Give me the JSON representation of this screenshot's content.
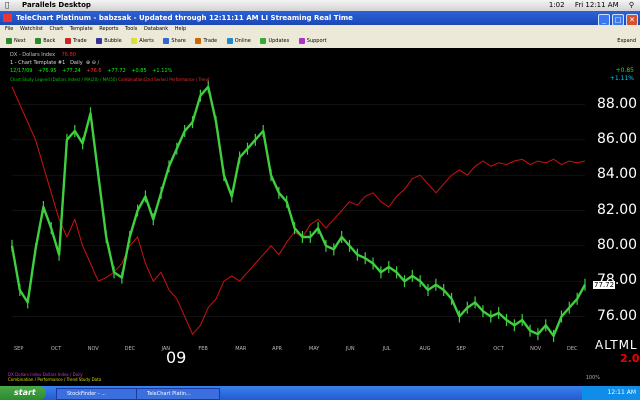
{
  "mac_menubar": {
    "app_name": "Parallels Desktop",
    "clock": "Fri 12:11 AM",
    "battery": "1:02"
  },
  "window": {
    "title": "TeleChart Platinum - babzsak - Updated through 12:11:11 AM LI  Streaming Real Time"
  },
  "menus": [
    "File",
    "Watchlist",
    "Chart",
    "Template",
    "Reports",
    "Tools",
    "Databank",
    "Help"
  ],
  "toolbar": {
    "buttons": [
      "Next",
      "Back",
      "Trade",
      "Bubble",
      "Alerts",
      "Share",
      "Trade",
      "Online",
      "Updates",
      "Support"
    ],
    "right_label": "Expand"
  },
  "chart_header": {
    "symbol_line": "DX - Dollars Index",
    "symbol_value": "76.80",
    "template_line": "1 - Chart Template #1",
    "interval": "Daily",
    "quote_line": [
      "12/17/09",
      "+76.95",
      "+77.24",
      "+76.6",
      "+77.72",
      "+0.85",
      "+1.11%"
    ],
    "indicator_line_a": "Chart Study Legend (Dollars Index) / MA(20) / MA(50)",
    "indicator_line_b": "Combination(2nd Series) Performance / Trend"
  },
  "top_right": {
    "change": "+0.85",
    "pct": "+1.11%"
  },
  "price_tag": "77.72",
  "bottom_right": {
    "altml": "ALTML",
    "value": "2.0"
  },
  "bottom_info": {
    "a": "DX  Dollars Index  Dollars Index / Daily",
    "b": "Combination / Performance / Trend  Study Data"
  },
  "status": "100%",
  "taskbar": {
    "start": "start",
    "tasks": [
      "StockFinder - ...",
      "TeleChart Platin..."
    ],
    "clock": "12:11 AM"
  },
  "chart_data": {
    "type": "line",
    "year_label": "09",
    "x": [
      "SEP",
      "OCT",
      "NOV",
      "DEC",
      "JAN",
      "FEB",
      "MAR",
      "APR",
      "MAY",
      "JUN",
      "JUL",
      "AUG",
      "SEP",
      "OCT",
      "NOV",
      "DEC"
    ],
    "ylim": [
      74.5,
      89.5
    ],
    "yticks": [
      76.0,
      78.0,
      80.0,
      82.0,
      84.0,
      86.0,
      88.0
    ],
    "series": [
      {
        "color": "#3fcf3f",
        "style": "bars",
        "values": [
          80.0,
          77.5,
          76.8,
          79.8,
          82.2,
          81.0,
          79.5,
          86.0,
          86.5,
          85.8,
          87.5,
          84.0,
          80.5,
          78.5,
          78.2,
          80.5,
          82.0,
          82.8,
          81.5,
          83.0,
          84.5,
          85.5,
          86.5,
          87.0,
          88.5,
          89.0,
          87.0,
          84.0,
          82.8,
          85.0,
          85.5,
          86.0,
          86.5,
          84.0,
          83.0,
          82.5,
          81.0,
          80.5,
          80.5,
          81.0,
          80.0,
          79.8,
          80.5,
          80.0,
          79.5,
          79.3,
          79.0,
          78.5,
          78.8,
          78.5,
          78.0,
          78.3,
          78.0,
          77.5,
          77.8,
          77.5,
          77.0,
          76.0,
          76.5,
          76.8,
          76.3,
          76.0,
          76.2,
          75.8,
          75.5,
          75.8,
          75.2,
          75.0,
          75.5,
          74.9,
          76.0,
          76.5,
          77.0,
          77.8
        ]
      },
      {
        "color": "#cc1111",
        "style": "line",
        "values": [
          89.0,
          88.0,
          87.0,
          86.0,
          84.5,
          83.0,
          81.5,
          80.5,
          81.5,
          80.0,
          79.0,
          78.0,
          78.2,
          78.5,
          79.0,
          80.0,
          80.5,
          79.0,
          78.0,
          78.5,
          77.5,
          77.0,
          76.0,
          75.0,
          75.5,
          76.5,
          77.0,
          78.0,
          78.3,
          78.0,
          78.5,
          79.0,
          79.5,
          80.0,
          79.5,
          80.2,
          80.8,
          80.5,
          81.2,
          81.5,
          81.0,
          81.5,
          82.0,
          82.5,
          82.3,
          82.8,
          83.0,
          82.5,
          82.2,
          82.8,
          83.2,
          83.8,
          84.0,
          83.5,
          83.0,
          83.5,
          84.0,
          84.3,
          84.0,
          84.5,
          84.8,
          84.5,
          84.7,
          84.6,
          84.8,
          84.9,
          84.6,
          84.8,
          84.7,
          84.9,
          84.6,
          84.8,
          84.7,
          84.8
        ]
      }
    ]
  }
}
